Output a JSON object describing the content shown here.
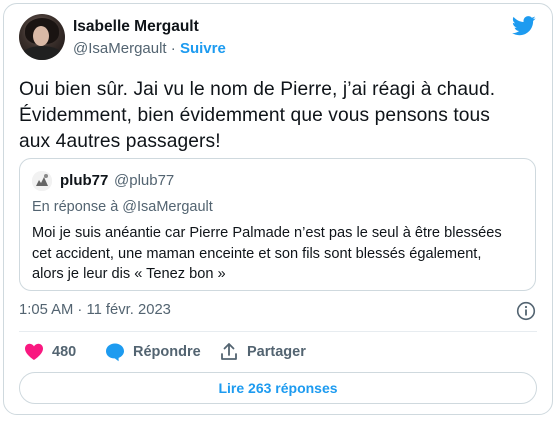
{
  "tweet": {
    "author": {
      "name": "Isabelle Mergault",
      "handle": "@IsaMergault",
      "separator": "·",
      "follow_label": "Suivre"
    },
    "text_lines": [
      "Oui bien sûr. Jai vu le nom de Pierre, j’ai réagi à chaud.",
      "Évidemment, bien évidemment que vous pensons tous",
      "aux 4autres passagers!"
    ],
    "timestamp": "1:05 AM · 11 févr. 2023"
  },
  "quoted_tweet": {
    "name": "plub77",
    "handle": "@plub77",
    "reply_to": "En réponse à @IsaMergault",
    "text_lines": [
      "Moi je suis anéantie car Pierre Palmade n’est pas le seul à être blessées",
      "cet accident, une maman enceinte et son fils sont blessés également,",
      "alors je leur dis « Tenez bon »"
    ]
  },
  "actions": {
    "like_count": "480",
    "reply_label": "Répondre",
    "share_label": "Partager",
    "read_replies_label": "Lire 263 réponses"
  },
  "icons": {
    "brand": "twitter-bird-icon",
    "info": "info-icon",
    "like": "heart-icon",
    "reply": "speech-bubble-icon",
    "share": "share-upload-icon"
  },
  "colors": {
    "accent": "#1d9bf0",
    "like": "#f91880",
    "text": "#0f1419",
    "secondary": "#536471",
    "border": "#cfd9de"
  }
}
